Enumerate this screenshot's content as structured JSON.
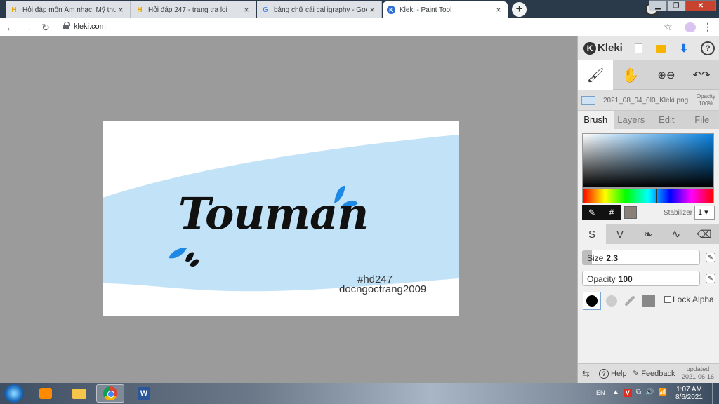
{
  "browser": {
    "tabs": [
      {
        "title": "Hỏi đáp môn Âm nhạc, Mỹ thuật",
        "favicon": "H"
      },
      {
        "title": "Hỏi đáp 247 - trang tra loi",
        "favicon": "H"
      },
      {
        "title": "bảng chữ cái calligraphy - Googl",
        "favicon": "G"
      },
      {
        "title": "Kleki - Paint Tool",
        "favicon": "K"
      }
    ],
    "close_glyph": "×",
    "new_tab_glyph": "+",
    "url": "kleki.com",
    "nav": {
      "back": "←",
      "forward": "→",
      "reload": "↻"
    },
    "star_glyph": "☆",
    "menu_glyph": "⋮",
    "window_buttons": {
      "minimize": "▁",
      "maximize": "❐",
      "close": "✕"
    }
  },
  "artwork": {
    "title": "Touman",
    "line1": "#hd247",
    "line2": "docngoctrang2009",
    "wash_color": "#bfe0f7",
    "accent_color": "#1e88e5"
  },
  "panel": {
    "logo_mark": "K",
    "logo": "Kleki",
    "help_glyph": "?",
    "save_glyph": "⬇",
    "tool_glyphs": {
      "brush": "🖌",
      "hand": "✋",
      "zoom": "⊕⊖",
      "undo": "↶↷"
    },
    "file_name": "2021_08_04_0l0_Kleki.png",
    "opacity_label": "Opacity",
    "opacity_value": "100%",
    "tabs": [
      "Brush",
      "Layers",
      "Edit",
      "File"
    ],
    "eyedropper_glyph": "✎",
    "hex_glyph": "#",
    "stabilizer_label": "Stabilizer",
    "stabilizer_value": "1",
    "brush_type_glyphs": [
      "S",
      "V",
      "❧",
      "∿",
      "⌫"
    ],
    "size_label": "Size",
    "size_value": "2.3",
    "size_fraction": 0.08,
    "opacity_slider_label": "Opacity",
    "opacity_slider_value": "100",
    "opacity_fraction": 1.0,
    "lock_alpha": "Lock Alpha",
    "footer": {
      "swap_glyph": "⇆",
      "help": "Help",
      "feedback": "Feedback",
      "updated_label": "updated",
      "updated_date": "2021-06-16"
    },
    "colors": {
      "primary_hex": "#0a83e0",
      "swatch_hex": "#8a7f78"
    }
  },
  "taskbar": {
    "word_glyph": "W",
    "language": "EN",
    "tray_glyphs": [
      "▲",
      "V",
      "⧉",
      "🔊",
      "📶"
    ],
    "time": "1:07 AM",
    "date": "8/6/2021"
  }
}
